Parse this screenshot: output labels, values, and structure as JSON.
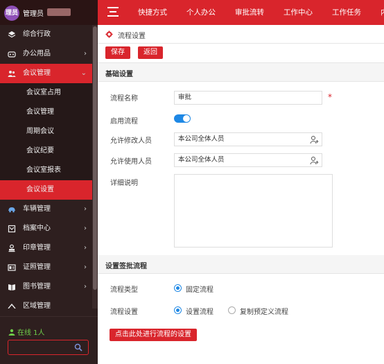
{
  "header": {
    "avatar_text": "理员",
    "admin_name": "管理员",
    "nav": [
      "快捷方式",
      "个人办公",
      "审批流转",
      "工作中心",
      "工作任务",
      "内"
    ]
  },
  "sidebar": {
    "items": [
      {
        "label": "综合行政",
        "icon": "layers-icon",
        "arrow": ""
      },
      {
        "label": "办公用品",
        "icon": "car-seat-icon",
        "arrow": "›"
      },
      {
        "label": "会议管理",
        "icon": "group-icon",
        "arrow": "⌄"
      }
    ],
    "subitems": [
      "会议室占用",
      "会议管理",
      "周期会议",
      "会议纪要",
      "会议室报表",
      "会议设置"
    ],
    "items2": [
      {
        "label": "车辆管理",
        "icon": "car-icon",
        "arrow": "›"
      },
      {
        "label": "档案中心",
        "icon": "archive-icon",
        "arrow": "›"
      },
      {
        "label": "印章管理",
        "icon": "seal-icon",
        "arrow": "›"
      },
      {
        "label": "证照管理",
        "icon": "id-card-icon",
        "arrow": "›"
      },
      {
        "label": "图书管理",
        "icon": "book-icon",
        "arrow": "›"
      },
      {
        "label": "区域管理",
        "icon": "region-icon",
        "arrow": ""
      }
    ],
    "online_text": "在线 1人",
    "search_placeholder": ""
  },
  "main": {
    "breadcrumb": "流程设置",
    "save_label": "保存",
    "back_label": "返回",
    "basic_section": "基础设置",
    "name_label": "流程名称",
    "name_value": "审批",
    "required_mark": "*",
    "enable_label": "启用流程",
    "enable_on": true,
    "edit_label": "允许修改人员",
    "edit_value": "本公司全体人员",
    "use_label": "允许使用人员",
    "use_value": "本公司全体人员",
    "desc_label": "详细说明",
    "sign_section": "设置签批流程",
    "type_label": "流程类型",
    "type_option": "固定流程",
    "setting_label": "流程设置",
    "setting_option1": "设置流程",
    "setting_option2": "复制预定义流程",
    "flow_button": "点击此处进行流程的设置"
  },
  "colors": {
    "brand_red": "#d9252c",
    "sidebar_bg": "#2e1f1f",
    "toggle_blue": "#1e88e5",
    "online_green": "#6fcf4a"
  }
}
